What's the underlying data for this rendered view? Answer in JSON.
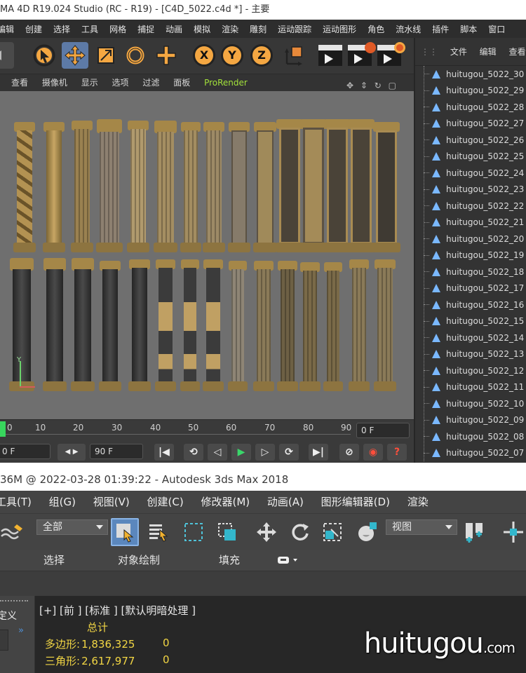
{
  "c4d": {
    "title": "MA 4D R19.024 Studio (RC - R19) - [C4D_5022.c4d *] - 主要",
    "menu": [
      "编辑",
      "创建",
      "选择",
      "工具",
      "网格",
      "捕捉",
      "动画",
      "模拟",
      "渲染",
      "雕刻",
      "运动跟踪",
      "运动图形",
      "角色",
      "流水线",
      "插件",
      "脚本",
      "窗口"
    ],
    "axis_buttons": [
      "X",
      "Y",
      "Z"
    ],
    "viewport_menu": [
      "查看",
      "摄像机",
      "显示",
      "选项",
      "过滤",
      "面板"
    ],
    "prorender_label": "ProRender",
    "timeline_ticks": [
      "0",
      "10",
      "20",
      "30",
      "40",
      "50",
      "60",
      "70",
      "80",
      "90"
    ],
    "current_frame": "0 F",
    "start_field": "0 F",
    "end_field": "90 F",
    "object_tabs": [
      "文件",
      "编辑",
      "查看"
    ],
    "objects": [
      "huitugou_5022_30",
      "huitugou_5022_29",
      "huitugou_5022_28",
      "huitugou_5022_27",
      "huitugou_5022_26",
      "huitugou_5022_25",
      "huitugou_5022_24",
      "huitugou_5022_23",
      "huitugou_5022_22",
      "huitugou_5022_21",
      "huitugou_5022_20",
      "huitugou_5022_19",
      "huitugou_5022_18",
      "huitugou_5022_17",
      "huitugou_5022_16",
      "huitugou_5022_15",
      "huitugou_5022_14",
      "huitugou_5022_13",
      "huitugou_5022_12",
      "huitugou_5022_11",
      "huitugou_5022_10",
      "huitugou_5022_09",
      "huitugou_5022_08",
      "huitugou_5022_07"
    ],
    "gizmo_y_label": "Y"
  },
  "max": {
    "title": "36M @ 2022-03-28 01:39:22 - Autodesk 3ds Max 2018",
    "menu": [
      "工具(T)",
      "组(G)",
      "视图(V)",
      "创建(C)",
      "修改器(M)",
      "动画(A)",
      "图形编辑器(D)",
      "渲染"
    ],
    "filter_dropdown": "全部",
    "ref_coord_dropdown": "视图",
    "ribbon": [
      "选择",
      "对象绘制",
      "填充"
    ],
    "left_panel_text": "定义",
    "viewport_label": "[+] [前 ] [标准 ] [默认明暗处理 ]",
    "stats_header": "总计",
    "stats": [
      {
        "label": "多边形:",
        "value": "1,836,325",
        "selected": "0"
      },
      {
        "label": "三角形:",
        "value": "2,617,977",
        "selected": "0"
      }
    ],
    "watermark": "huitugou",
    "watermark_suffix": ".com"
  }
}
